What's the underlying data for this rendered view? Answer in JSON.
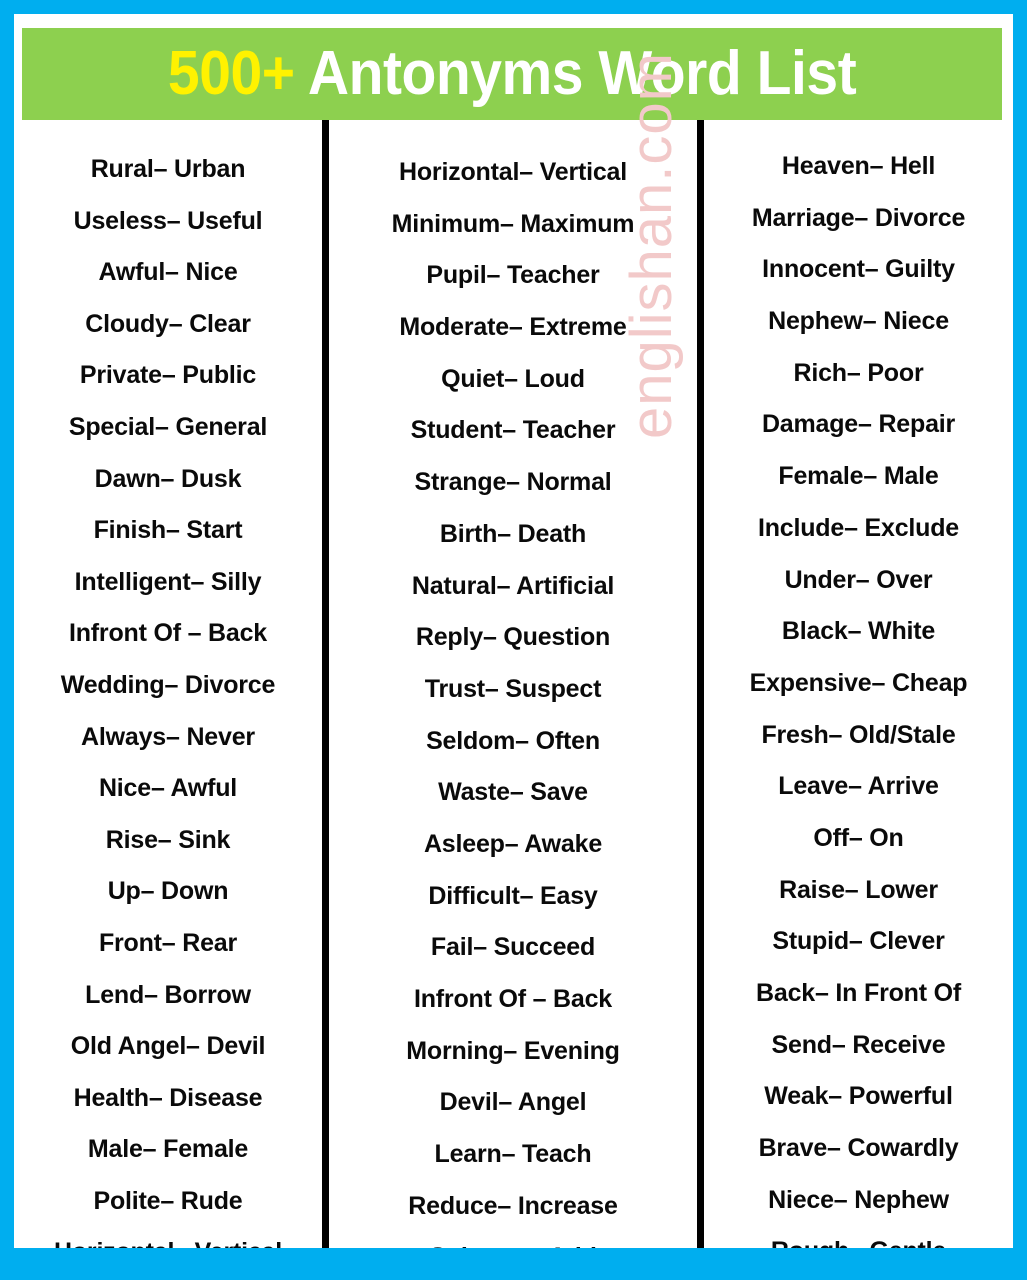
{
  "banner": {
    "highlight": "500+",
    "title_rest": " Antonyms Word List",
    "full_title": "500+ Antonyms Word List",
    "background_color": "#8DD04F",
    "highlight_color": "#FFF200",
    "text_color": "#FFFFFF"
  },
  "frame": {
    "border_color": "#00AEEF",
    "page_color": "#FFFFFF",
    "divider_color": "#000000"
  },
  "watermark": {
    "text": "englishan.com",
    "color": "#F2C9C9",
    "rotation": "-90deg"
  },
  "columns": [
    {
      "id": "column-1",
      "items": [
        "Rural– Urban",
        "Useless– Useful",
        "Awful– Nice",
        "Cloudy– Clear",
        "Private– Public",
        "Special– General",
        "Dawn– Dusk",
        "Finish– Start",
        "Intelligent– Silly",
        "Infront Of – Back",
        "Wedding– Divorce",
        "Always– Never",
        "Nice– Awful",
        "Rise– Sink",
        "Up– Down",
        "Front– Rear",
        "Lend– Borrow",
        "Old Angel– Devil",
        "Health– Disease",
        "Male– Female",
        "Polite– Rude",
        "Horizontal– Vertical"
      ]
    },
    {
      "id": "column-2",
      "items": [
        "Horizontal– Vertical",
        "Minimum– Maximum",
        "Pupil– Teacher",
        "Moderate– Extreme",
        "Quiet– Loud",
        "Student– Teacher",
        "Strange– Normal",
        "Birth– Death",
        "Natural– Artificial",
        "Reply– Question",
        "Trust– Suspect",
        "Seldom– Often",
        "Waste– Save",
        "Asleep– Awake",
        "Difficult– Easy",
        "Fail– Succeed",
        "Infront Of – Back",
        "Morning– Evening",
        "Devil– Angel",
        "Learn– Teach",
        "Reduce– Increase",
        "Subtract– Add"
      ]
    },
    {
      "id": "column-3",
      "items": [
        "Heaven– Hell",
        "Marriage– Divorce",
        "Innocent– Guilty",
        "Nephew– Niece",
        "Rich– Poor",
        "Damage– Repair",
        "Female– Male",
        "Include– Exclude",
        "Under– Over",
        "Black– White",
        "Expensive– Cheap",
        "Fresh– Old/Stale",
        "Leave– Arrive",
        "Off– On",
        "Raise– Lower",
        "Stupid– Clever",
        "Back– In Front Of",
        "Send– Receive",
        "Weak– Powerful",
        "Brave– Cowardly",
        "Niece– Nephew",
        "Rough– Gentle"
      ]
    }
  ]
}
